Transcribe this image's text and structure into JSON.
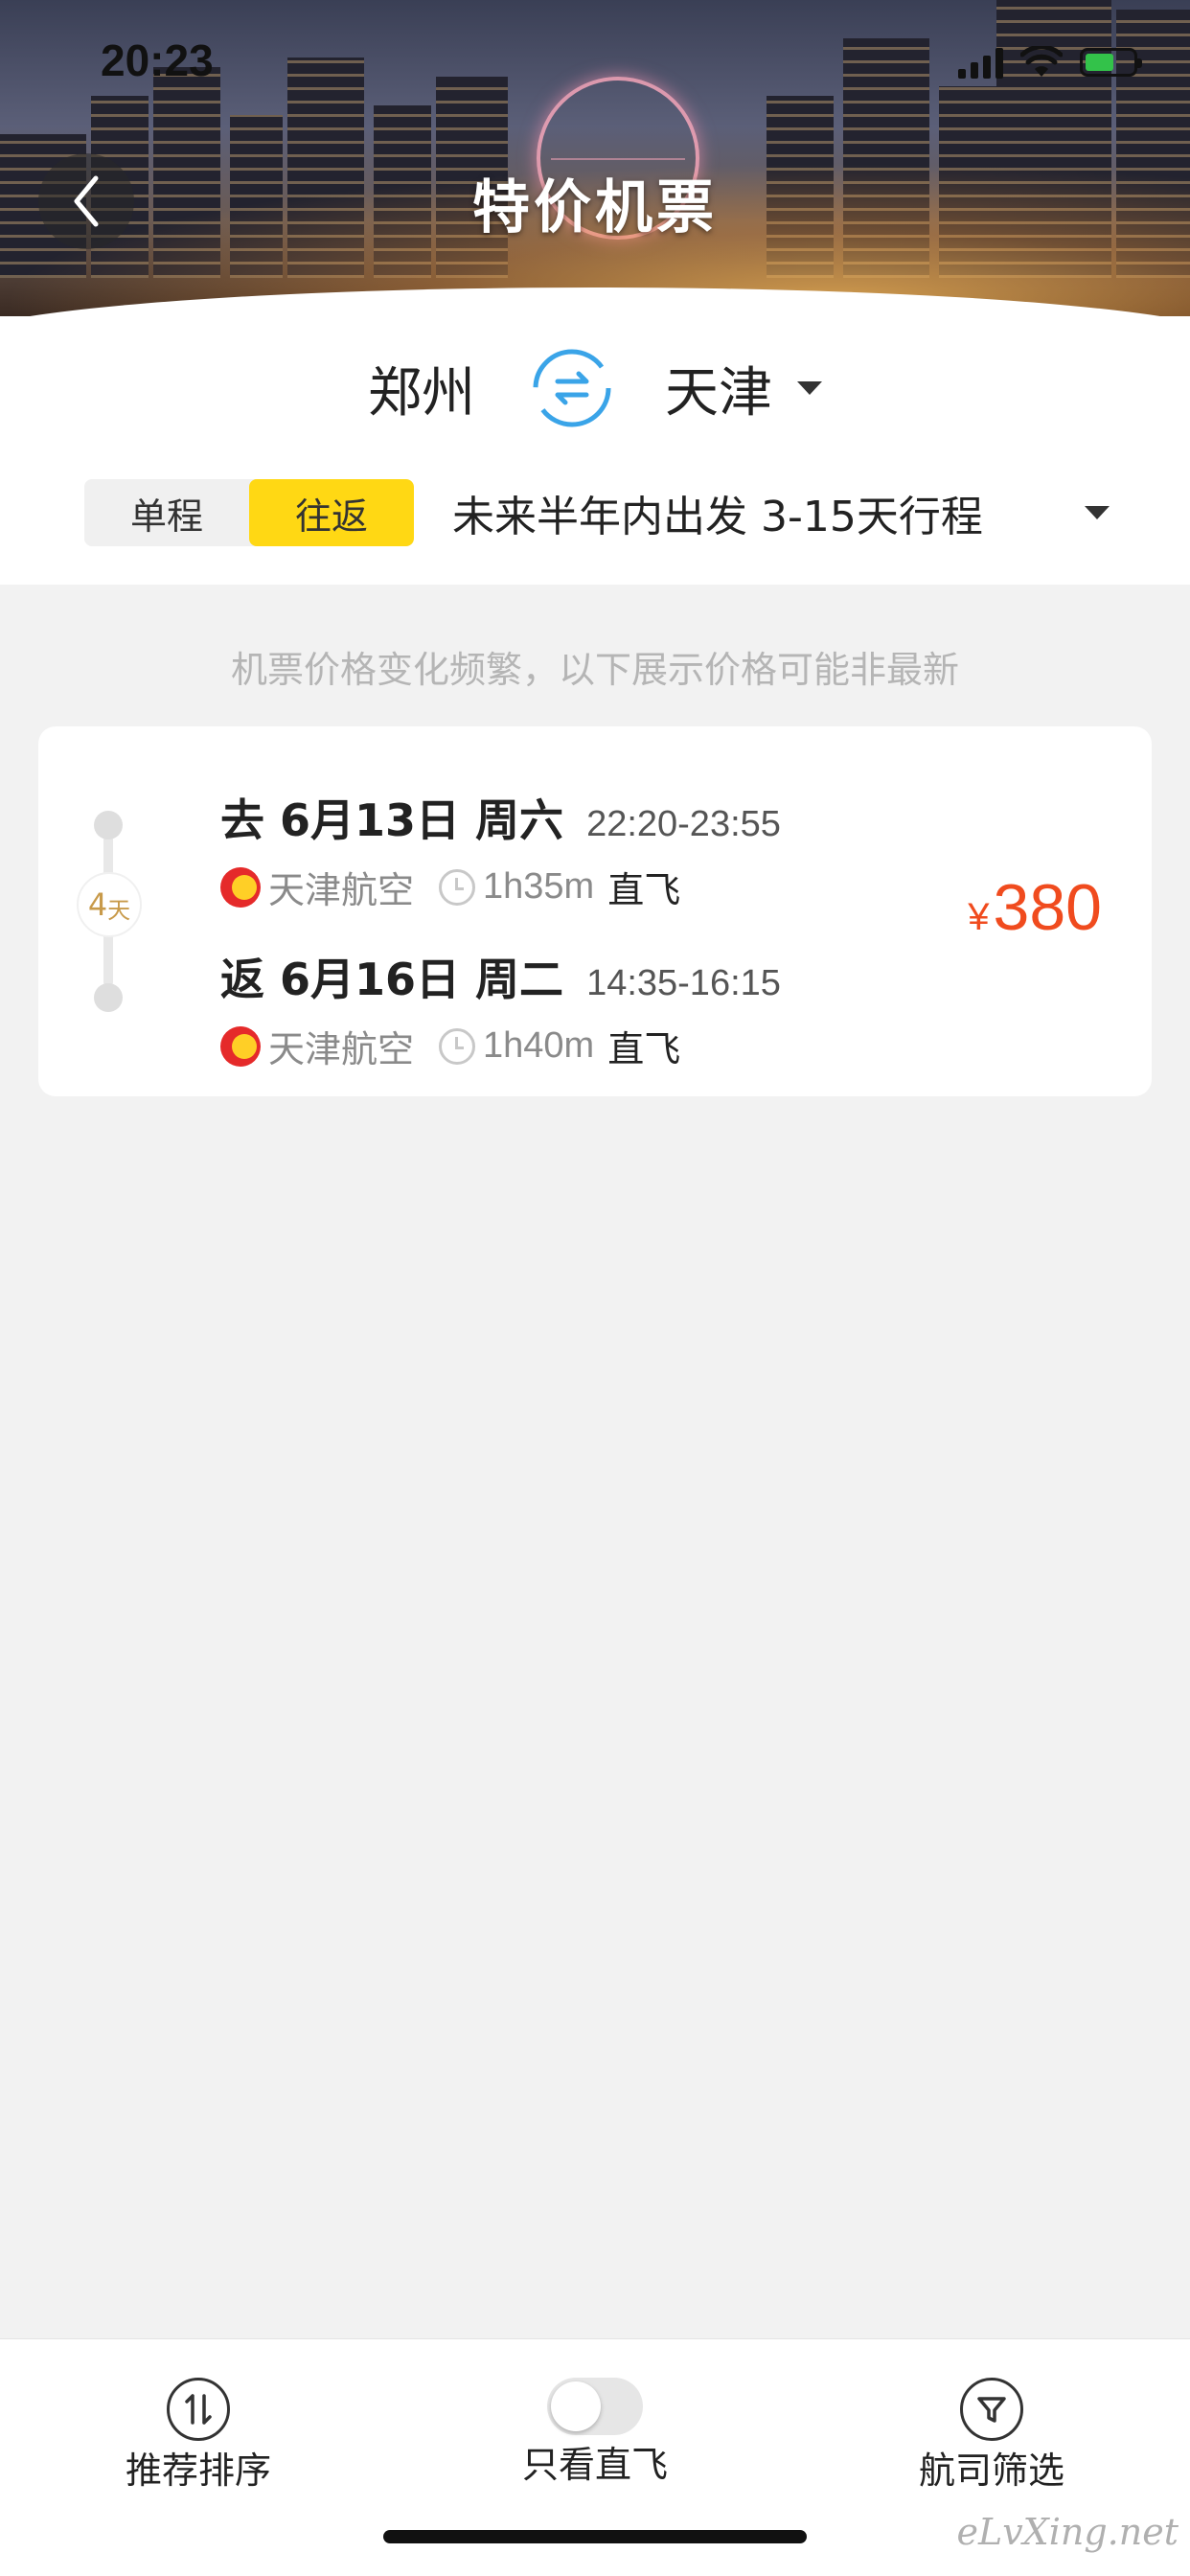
{
  "status_bar": {
    "time": "20:23"
  },
  "header": {
    "title": "特价机票"
  },
  "route": {
    "from": "郑州",
    "to": "天津"
  },
  "trip_type": {
    "options": [
      "单程",
      "往返"
    ],
    "selected": "往返"
  },
  "trip_range": "未来半年内出发 3-15天行程",
  "notice": "机票价格变化频繁，以下展示价格可能非最新",
  "result": {
    "duration_days": "4",
    "duration_unit": "天",
    "outbound": {
      "direction_date": "去 6月13日 周六",
      "time": "22:20-23:55",
      "airline": "天津航空",
      "duration": "1h35m",
      "direct": "直飞"
    },
    "return": {
      "direction_date": "返 6月16日 周二",
      "time": "14:35-16:15",
      "airline": "天津航空",
      "duration": "1h40m",
      "direct": "直飞"
    },
    "currency": "¥",
    "price": "380"
  },
  "bottom_bar": {
    "sort_label": "推荐排序",
    "direct_only_label": "只看直飞",
    "direct_only_on": false,
    "airline_filter_label": "航司筛选"
  },
  "watermark": "eLvXing.net",
  "colors": {
    "accent_yellow": "#ffd814",
    "price_red": "#f04b1e",
    "swap_blue": "#3aa4e8",
    "airline_red": "#e52a2a"
  }
}
